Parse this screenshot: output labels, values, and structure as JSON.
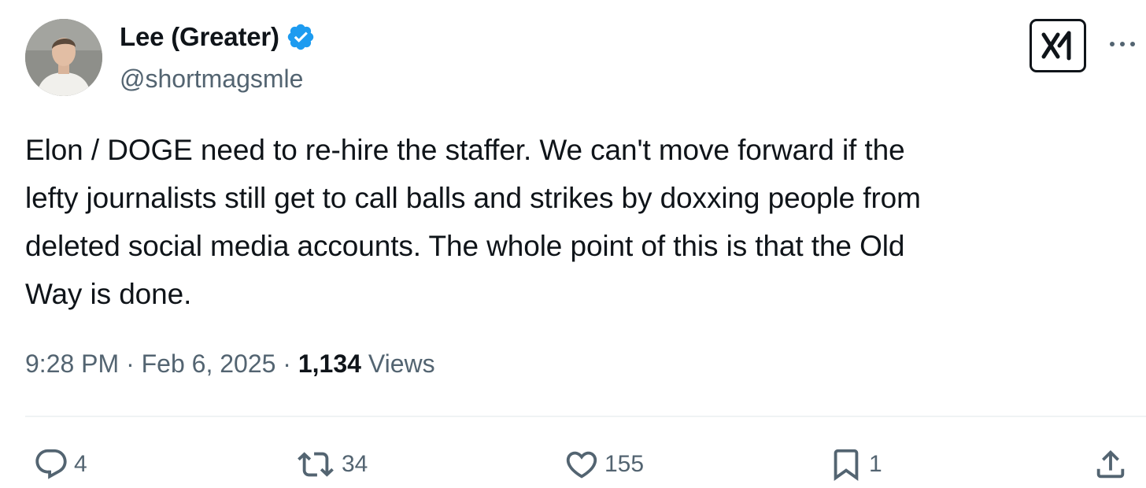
{
  "author": {
    "display_name": "Lee (Greater)",
    "handle": "@shortmagsmle",
    "verified": true,
    "verified_color": "#1d9bf0"
  },
  "tweet": {
    "text": "Elon / DOGE need to re-hire the staffer. We can't move forward if the\nlefty journalists still get to call balls and strikes by doxxing people from\ndeleted social media accounts. The whole point of this is that the Old\nWay is done.",
    "time": "9:28 PM",
    "separator": " · ",
    "date": "Feb 6, 2025",
    "views_count": "1,134",
    "views_label": " Views"
  },
  "header_icons": {
    "grok": "grok-icon",
    "more": "more-horizontal-icon"
  },
  "actions": {
    "replies": {
      "icon": "reply-icon",
      "count": "4"
    },
    "reposts": {
      "icon": "repost-icon",
      "count": "34"
    },
    "likes": {
      "icon": "like-icon",
      "count": "155"
    },
    "bookmarks": {
      "icon": "bookmark-icon",
      "count": "1"
    },
    "share": {
      "icon": "share-icon"
    }
  },
  "colors": {
    "text_primary": "#0f1419",
    "text_secondary": "#536471",
    "divider": "#eff3f4"
  }
}
